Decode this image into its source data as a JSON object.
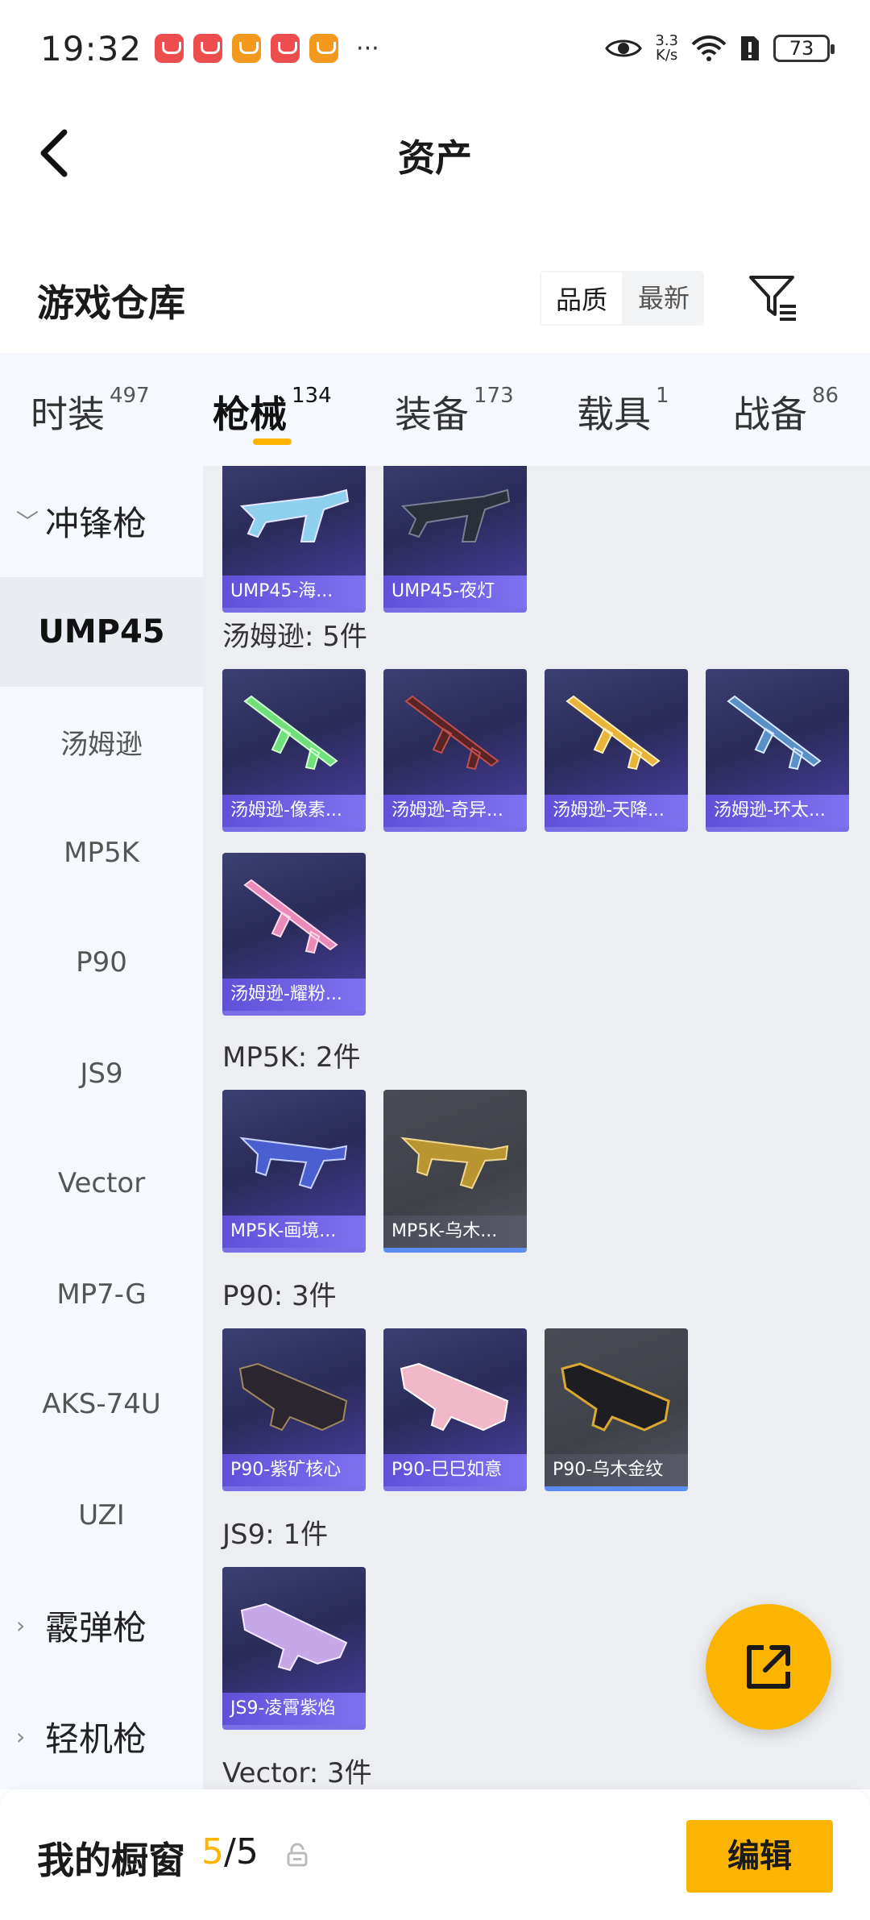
{
  "status_bar": {
    "time": "19:32",
    "more": "···",
    "net_speed_value": "3.3",
    "net_speed_unit": "K/s",
    "battery": "73"
  },
  "header": {
    "title": "资产"
  },
  "warehouse": {
    "title": "游戏仓库",
    "sort_options": [
      "品质",
      "最新"
    ],
    "selected_sort": "品质"
  },
  "tabs": [
    {
      "label": "时装",
      "count": "497"
    },
    {
      "label": "枪械",
      "count": "134",
      "active": true
    },
    {
      "label": "装备",
      "count": "173"
    },
    {
      "label": "载具",
      "count": "1"
    },
    {
      "label": "战备",
      "count": "86"
    }
  ],
  "sidebar": {
    "group_smg": "冲锋枪",
    "items": [
      "UMP45",
      "汤姆逊",
      "MP5K",
      "P90",
      "JS9",
      "Vector",
      "MP7-G",
      "AKS-74U",
      "UZI"
    ],
    "selected": "UMP45",
    "group_shotgun": "霰弹枪",
    "group_lmg": "轻机枪"
  },
  "content": {
    "ump45_cards": [
      "UMP45-海...",
      "UMP45-夜灯"
    ],
    "thompson_label": "汤姆逊: 5件",
    "thompson_cards": [
      "汤姆逊-像素...",
      "汤姆逊-奇异...",
      "汤姆逊-天降...",
      "汤姆逊-环太...",
      "汤姆逊-耀粉..."
    ],
    "mp5k_label": "MP5K: 2件",
    "mp5k_cards": [
      "MP5K-画境...",
      "MP5K-乌木..."
    ],
    "p90_label": "P90: 3件",
    "p90_cards": [
      "P90-紫矿核心",
      "P90-巳巳如意",
      "P90-乌木金纹"
    ],
    "js9_label": "JS9: 1件",
    "js9_cards": [
      "JS9-凌霄紫焰"
    ],
    "vector_label": "Vector: 3件"
  },
  "bottom_bar": {
    "label": "我的橱窗",
    "current": "5",
    "separator": "/",
    "total": "5",
    "edit_label": "编辑"
  },
  "colors": {
    "accent": "#fbb400",
    "card_purple": "#2a2b58",
    "card_grey": "#3f4149",
    "sidebar_bg": "#f5f8fc",
    "content_bg": "#eceef2"
  }
}
